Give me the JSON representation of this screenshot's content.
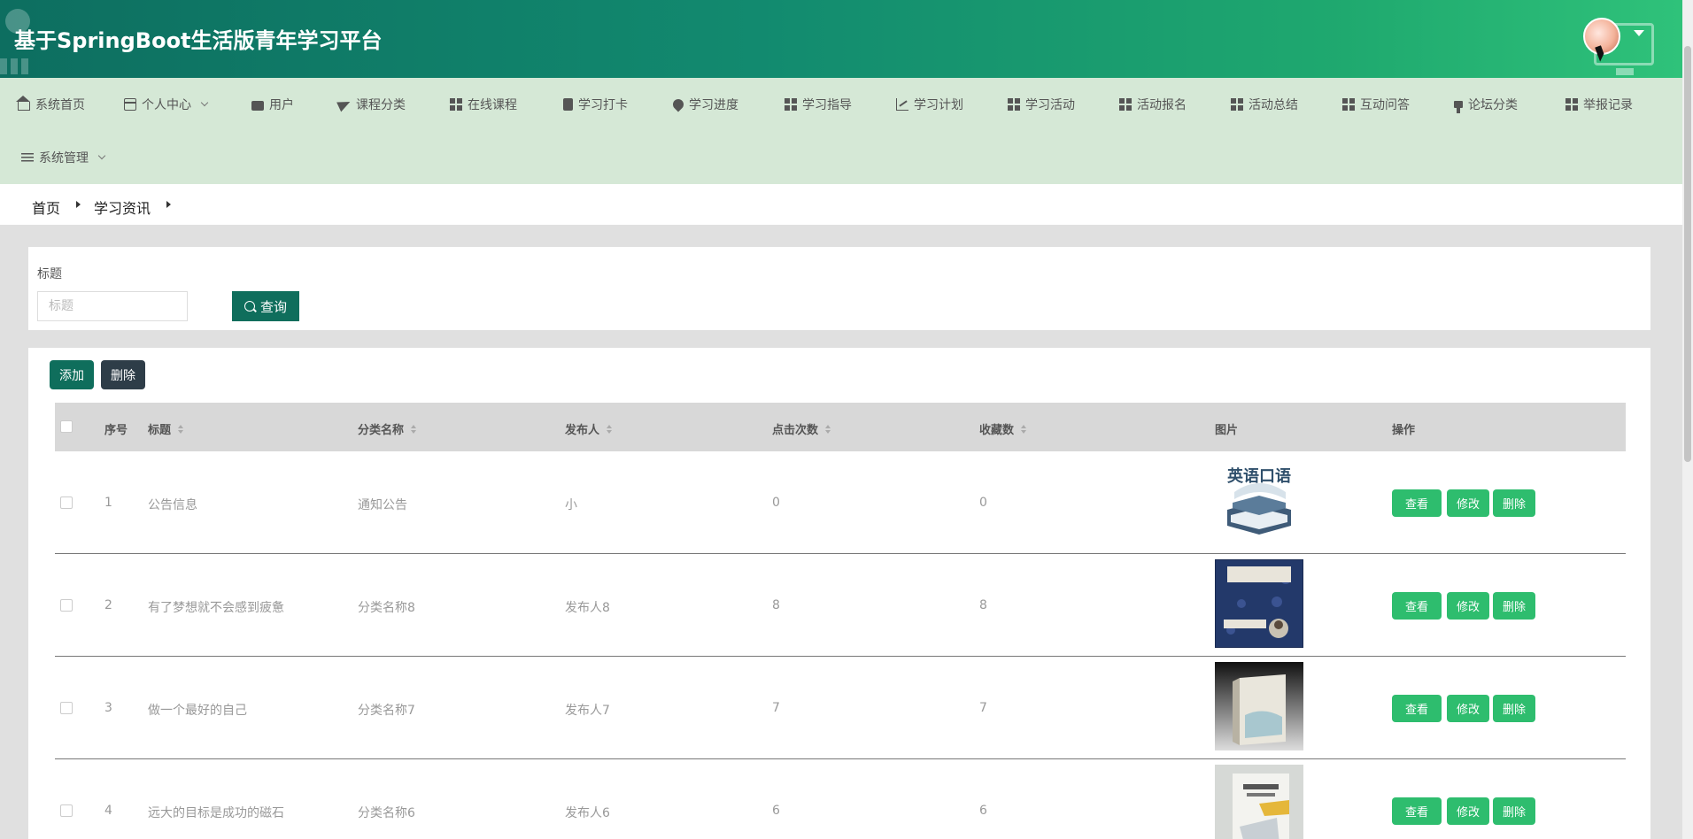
{
  "header": {
    "title": "基于SpringBoot生活版青年学习平台"
  },
  "nav": {
    "items": [
      {
        "label": "系统首页",
        "icon": "home-icon"
      },
      {
        "label": "个人中心",
        "icon": "card-icon",
        "has_dropdown": true
      },
      {
        "label": "用户",
        "icon": "briefcase-icon"
      },
      {
        "label": "课程分类",
        "icon": "send-icon"
      },
      {
        "label": "在线课程",
        "icon": "grid-icon"
      },
      {
        "label": "学习打卡",
        "icon": "clipboard-icon"
      },
      {
        "label": "学习进度",
        "icon": "pin-icon"
      },
      {
        "label": "学习指导",
        "icon": "grid-icon"
      },
      {
        "label": "学习计划",
        "icon": "chart-icon"
      },
      {
        "label": "学习活动",
        "icon": "grid-icon"
      },
      {
        "label": "活动报名",
        "icon": "grid-icon"
      },
      {
        "label": "活动总结",
        "icon": "grid-icon"
      },
      {
        "label": "互动问答",
        "icon": "grid-icon"
      },
      {
        "label": "论坛分类",
        "icon": "brush-icon"
      },
      {
        "label": "举报记录",
        "icon": "grid-icon"
      },
      {
        "label": "系统管理",
        "icon": "sliders-icon",
        "has_dropdown": true
      }
    ]
  },
  "breadcrumb": {
    "items": [
      "首页",
      "学习资讯"
    ]
  },
  "search": {
    "label": "标题",
    "placeholder": "标题",
    "value": "",
    "button_label": "查询"
  },
  "toolbar": {
    "add_label": "添加",
    "delete_label": "删除"
  },
  "table": {
    "columns": [
      "序号",
      "标题",
      "分类名称",
      "发布人",
      "点击次数",
      "收藏数",
      "图片",
      "操作"
    ],
    "rows": [
      {
        "index": "1",
        "title": "公告信息",
        "category": "通知公告",
        "publisher": "小",
        "clicks": "0",
        "favorites": "0",
        "image": "英语口语"
      },
      {
        "index": "2",
        "title": "有了梦想就不会感到疲惫",
        "category": "分类名称8",
        "publisher": "发布人8",
        "clicks": "8",
        "favorites": "8",
        "image": ""
      },
      {
        "index": "3",
        "title": "做一个最好的自己",
        "category": "分类名称7",
        "publisher": "发布人7",
        "clicks": "7",
        "favorites": "7",
        "image": ""
      },
      {
        "index": "4",
        "title": "远大的目标是成功的磁石",
        "category": "分类名称6",
        "publisher": "发布人6",
        "clicks": "6",
        "favorites": "6",
        "image": ""
      }
    ],
    "actions": {
      "view": "查看",
      "edit": "修改",
      "delete": "删除"
    }
  },
  "colors": {
    "header_start": "#0d6e60",
    "header_end": "#2fc27a",
    "nav_bg": "#d5e8d6",
    "primary": "#0f6e5c",
    "action": "#2ebd6e",
    "dark_button": "#2e3d48"
  }
}
